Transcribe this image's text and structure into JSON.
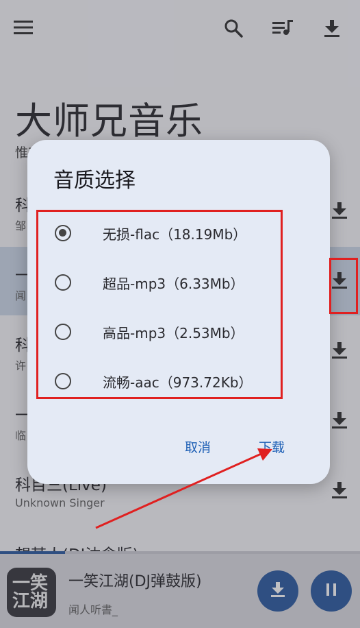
{
  "app": {
    "title": "大师兄音乐",
    "subtitle": "惟有"
  },
  "topbar": {
    "menu_icon": "menu-icon",
    "search_icon": "search-icon",
    "playlist_icon": "playlist-icon",
    "download_icon": "download-icon"
  },
  "songs": [
    {
      "name": "科",
      "artist": "邹"
    },
    {
      "name": "一",
      "artist": "闻"
    },
    {
      "name": "科",
      "artist": "许"
    },
    {
      "name": "一",
      "artist": "临"
    },
    {
      "name": "科目三(Live)",
      "artist": "Unknown Singer"
    },
    {
      "name": "想某人(DJ沈念版)",
      "artist": ""
    }
  ],
  "player": {
    "title": "一笑江湖(DJ弹鼓版)",
    "artist": "闻人听書_",
    "cover_text": "一笑\n江湖",
    "progress": 0.18
  },
  "dialog": {
    "title": "音质选择",
    "options": [
      {
        "label": "无损-flac（18.19Mb）",
        "selected": true
      },
      {
        "label": "超品-mp3（6.33Mb）",
        "selected": false
      },
      {
        "label": "高品-mp3（2.53Mb）",
        "selected": false
      },
      {
        "label": "流畅-aac（973.72Kb）",
        "selected": false
      }
    ],
    "cancel_label": "取消",
    "confirm_label": "下载"
  },
  "colors": {
    "accent": "#1d4f9a",
    "annotation": "#e02020"
  }
}
